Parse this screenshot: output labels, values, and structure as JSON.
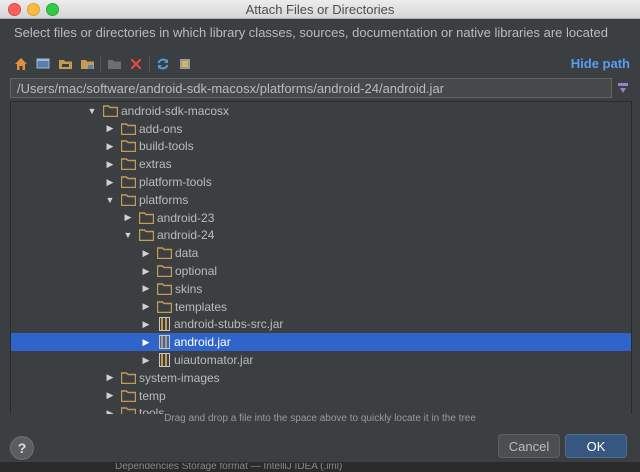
{
  "window": {
    "title": "Attach Files or Directories"
  },
  "description": "Select files or directories in which library classes, sources, documentation or native libraries are located",
  "toolbar": {
    "icons": [
      "home-icon",
      "desktop-icon",
      "project-folder-icon",
      "module-folder-icon",
      "new-folder-icon",
      "delete-icon",
      "refresh-icon",
      "show-hidden-icon"
    ],
    "hide_path_label": "Hide path"
  },
  "path": {
    "value": "/Users/mac/software/android-sdk-macosx/platforms/android-24/android.jar"
  },
  "tree": {
    "rows": [
      {
        "label": "android-sdk-macosx",
        "type": "folder",
        "level": 0,
        "state": "expanded"
      },
      {
        "label": "add-ons",
        "type": "folder",
        "level": 1,
        "state": "collapsed"
      },
      {
        "label": "build-tools",
        "type": "folder",
        "level": 1,
        "state": "collapsed"
      },
      {
        "label": "extras",
        "type": "folder",
        "level": 1,
        "state": "collapsed"
      },
      {
        "label": "platform-tools",
        "type": "folder",
        "level": 1,
        "state": "collapsed"
      },
      {
        "label": "platforms",
        "type": "folder",
        "level": 1,
        "state": "expanded"
      },
      {
        "label": "android-23",
        "type": "folder",
        "level": 2,
        "state": "collapsed"
      },
      {
        "label": "android-24",
        "type": "folder",
        "level": 2,
        "state": "expanded"
      },
      {
        "label": "data",
        "type": "folder",
        "level": 3,
        "state": "collapsed"
      },
      {
        "label": "optional",
        "type": "folder",
        "level": 3,
        "state": "collapsed"
      },
      {
        "label": "skins",
        "type": "folder",
        "level": 3,
        "state": "collapsed"
      },
      {
        "label": "templates",
        "type": "folder",
        "level": 3,
        "state": "collapsed"
      },
      {
        "label": "android-stubs-src.jar",
        "type": "jar",
        "level": 3,
        "state": "collapsed"
      },
      {
        "label": "android.jar",
        "type": "jar",
        "level": 3,
        "state": "collapsed",
        "selected": true
      },
      {
        "label": "uiautomator.jar",
        "type": "jar",
        "level": 3,
        "state": "collapsed"
      },
      {
        "label": "system-images",
        "type": "folder",
        "level": 1,
        "state": "collapsed"
      },
      {
        "label": "temp",
        "type": "folder",
        "level": 1,
        "state": "collapsed"
      },
      {
        "label": "tools",
        "type": "folder",
        "level": 1,
        "state": "collapsed"
      }
    ]
  },
  "hint": "Drag and drop a file into the space above to quickly locate it in the tree",
  "buttons": {
    "help": "?",
    "cancel": "Cancel",
    "ok": "OK"
  },
  "background_text": "Dependencies Storage format — IntelliJ IDEA (.iml)",
  "colors": {
    "folder": "#c59a52",
    "selection": "#2f65ca",
    "link": "#589df6",
    "ok_button": "#365880"
  }
}
